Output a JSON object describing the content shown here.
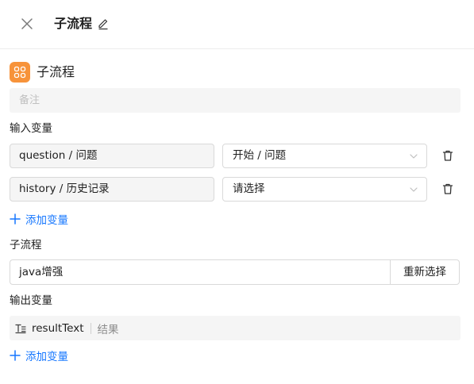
{
  "header": {
    "title": "子流程"
  },
  "node": {
    "title": "子流程"
  },
  "remark": {
    "placeholder": "备注"
  },
  "input_section": {
    "label": "输入变量",
    "rows": [
      {
        "name": "question / 问题",
        "value": "开始 / 问题"
      },
      {
        "name": "history / 历史记录",
        "value": "请选择"
      }
    ],
    "add_label": "添加变量"
  },
  "subflow_section": {
    "label": "子流程",
    "value": "java增强",
    "reselect_label": "重新选择"
  },
  "output_section": {
    "label": "输出变量",
    "rows": [
      {
        "name": "resultText",
        "desc": "结果",
        "type_icon": "text-type-icon"
      }
    ],
    "add_label": "添加变量"
  },
  "colors": {
    "accent": "#1677ff",
    "node_icon_bg": "#f7933a"
  }
}
